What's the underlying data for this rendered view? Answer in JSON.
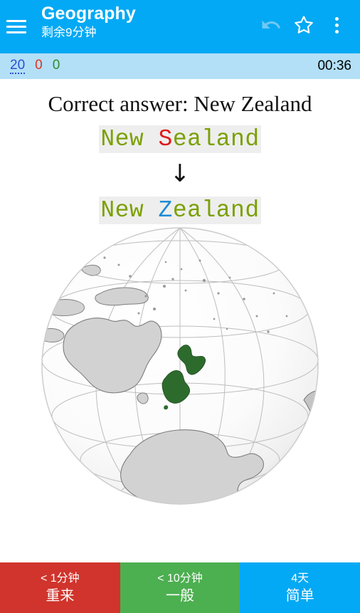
{
  "header": {
    "menu_icon": "hamburger-menu-icon",
    "title": "Geography",
    "subtitle": "剩余9分钟",
    "undo_icon": "undo-arrow-icon",
    "star_icon": "star-outline-icon",
    "more_icon": "three-dot-overflow-icon"
  },
  "stats": {
    "new_count": "20",
    "learning_count": "0",
    "due_count": "0",
    "timer": "00:36",
    "new_color": "#2a4fd6",
    "learning_color": "#e03020",
    "due_color": "#2e8b2e"
  },
  "answer": {
    "correct_label": "Correct answer: New Zealand",
    "typed": [
      {
        "text": "New ",
        "state": "ok"
      },
      {
        "text": "S",
        "state": "bad"
      },
      {
        "text": "ealand",
        "state": "ok"
      }
    ],
    "arrow": "↓",
    "expected": [
      {
        "text": "New ",
        "state": "ok"
      },
      {
        "text": "Z",
        "state": "fix"
      },
      {
        "text": "ealand",
        "state": "ok"
      }
    ],
    "ok_color": "#7ba005",
    "bad_color": "#e01b1b",
    "fix_color": "#1e8ad6",
    "highlight_bg": "#eeeeee"
  },
  "globe": {
    "alt": "orthographic globe centered on New Zealand",
    "highlight_country": "New Zealand",
    "highlight_color": "#2d6b2d",
    "land_color": "#d2d2d2",
    "land_outline": "#8a8a8a",
    "ocean_color": "#f7f7f7",
    "graticule_color": "#b9b9b9"
  },
  "answer_buttons": [
    {
      "interval": "< 1分钟",
      "label": "重来",
      "color": "#d0342c"
    },
    {
      "interval": "< 10分钟",
      "label": "一般",
      "color": "#4caf50"
    },
    {
      "interval": "4天",
      "label": "简单",
      "color": "#03a9f4"
    }
  ]
}
